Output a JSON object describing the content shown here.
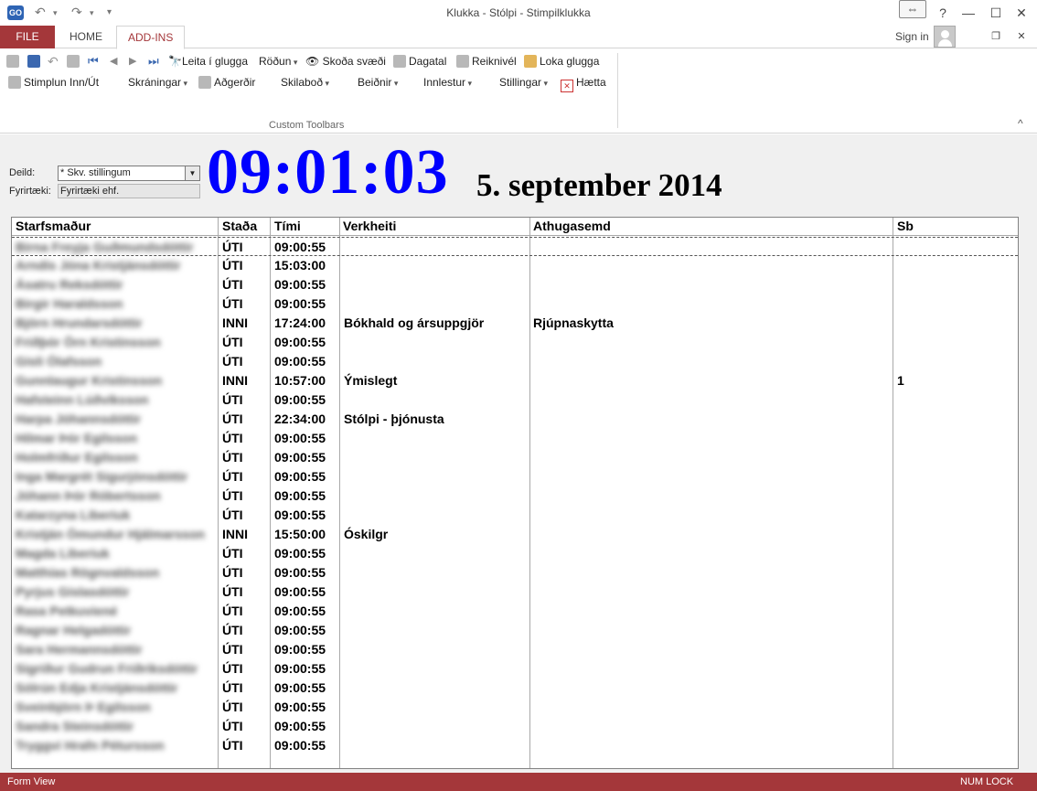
{
  "window": {
    "title": "Klukka - Stólpi - Stimpilklukka",
    "help": "?",
    "minimize": "—",
    "maximize": "☐",
    "close": "✕",
    "restore_ribbon": "⇔",
    "app_icon_text": "GO"
  },
  "tabs": {
    "file": "FILE",
    "home": "HOME",
    "addins": "ADD-INS"
  },
  "account": {
    "signin": "Sign in"
  },
  "ribbon": {
    "row1": {
      "leita": "Leita í glugga",
      "rodun": "Röðun",
      "skoda": "Skoða svæði",
      "dagatal": "Dagatal",
      "reiknivel": "Reiknivél",
      "loka": "Loka glugga"
    },
    "row2": {
      "stimplun": "Stimplun Inn/Út",
      "skraningar": "Skráningar",
      "adgerdir": "Aðgerðir",
      "skilabod": "Skilaboð",
      "beidnir": "Beiðnir",
      "innlestur": "Innlestur",
      "stillingar": "Stillingar",
      "haetta": "Hætta"
    },
    "group_label": "Custom Toolbars"
  },
  "form": {
    "deild_label": "Deild:",
    "deild_value": "* Skv. stillingum",
    "fyrirtaeki_label": "Fyrirtæki:",
    "fyrirtaeki_value": "Fyrirtæki ehf.",
    "clock": "09:01:03",
    "date": "5. september 2014"
  },
  "grid": {
    "columns": [
      "Starfsmaður",
      "Staða",
      "Tími",
      "Verkheiti",
      "Athugasemd",
      "Sb"
    ],
    "rows": [
      {
        "name": "Birna Freyja Guðmundsdóttir",
        "stada": "ÚTI",
        "timi": "09:00:55",
        "verk": "",
        "aths": "",
        "sb": ""
      },
      {
        "name": "Arndís Jóna Kristjánsdóttir",
        "stada": "ÚTI",
        "timi": "15:03:00",
        "verk": "",
        "aths": "",
        "sb": ""
      },
      {
        "name": "Ásatru Reksdóttir",
        "stada": "ÚTI",
        "timi": "09:00:55",
        "verk": "",
        "aths": "",
        "sb": ""
      },
      {
        "name": "Birgir Haraldsson",
        "stada": "ÚTI",
        "timi": "09:00:55",
        "verk": "",
        "aths": "",
        "sb": ""
      },
      {
        "name": "Björn Hrundarsdóttir",
        "stada": "INNI",
        "timi": "17:24:00",
        "verk": "Bókhald og ársuppgjör",
        "aths": "Rjúpnaskytta",
        "sb": ""
      },
      {
        "name": "Friðþór Örn Kristinsson",
        "stada": "ÚTI",
        "timi": "09:00:55",
        "verk": "",
        "aths": "",
        "sb": ""
      },
      {
        "name": "Gísli Ólafsson",
        "stada": "ÚTI",
        "timi": "09:00:55",
        "verk": "",
        "aths": "",
        "sb": ""
      },
      {
        "name": "Gunnlaugur Kristinsson",
        "stada": "INNI",
        "timi": "10:57:00",
        "verk": "Ýmislegt",
        "aths": "",
        "sb": "1"
      },
      {
        "name": "Hafsteinn Lúðvíksson",
        "stada": "ÚTI",
        "timi": "09:00:55",
        "verk": "",
        "aths": "",
        "sb": ""
      },
      {
        "name": "Harpa Jóhannsdóttir",
        "stada": "ÚTI",
        "timi": "22:34:00",
        "verk": "Stólpi - þjónusta",
        "aths": "",
        "sb": ""
      },
      {
        "name": "Hilmar Þór Egilsson",
        "stada": "ÚTI",
        "timi": "09:00:55",
        "verk": "",
        "aths": "",
        "sb": ""
      },
      {
        "name": "Holmfríður Egilsson",
        "stada": "ÚTI",
        "timi": "09:00:55",
        "verk": "",
        "aths": "",
        "sb": ""
      },
      {
        "name": "Inga Margrét Sigurjónsdóttir",
        "stada": "ÚTI",
        "timi": "09:00:55",
        "verk": "",
        "aths": "",
        "sb": ""
      },
      {
        "name": "Jóhann Þór Róbertsson",
        "stada": "ÚTI",
        "timi": "09:00:55",
        "verk": "",
        "aths": "",
        "sb": ""
      },
      {
        "name": "Katarzyna Liberiuk",
        "stada": "ÚTI",
        "timi": "09:00:55",
        "verk": "",
        "aths": "",
        "sb": ""
      },
      {
        "name": "Kristján Ómundur Hjálmarsson",
        "stada": "INNI",
        "timi": "15:50:00",
        "verk": "Óskilgr",
        "aths": "",
        "sb": ""
      },
      {
        "name": "Magda Liberiuk",
        "stada": "ÚTI",
        "timi": "09:00:55",
        "verk": "",
        "aths": "",
        "sb": ""
      },
      {
        "name": "Matthías Rögnvaldsson",
        "stada": "ÚTI",
        "timi": "09:00:55",
        "verk": "",
        "aths": "",
        "sb": ""
      },
      {
        "name": "Pyrjus Gíslasdóttir",
        "stada": "ÚTI",
        "timi": "09:00:55",
        "verk": "",
        "aths": "",
        "sb": ""
      },
      {
        "name": "Rasa Petkuviené",
        "stada": "ÚTI",
        "timi": "09:00:55",
        "verk": "",
        "aths": "",
        "sb": ""
      },
      {
        "name": "Ragnar Helgadóttir",
        "stada": "ÚTI",
        "timi": "09:00:55",
        "verk": "",
        "aths": "",
        "sb": ""
      },
      {
        "name": "Sara Hermannsdóttir",
        "stada": "ÚTI",
        "timi": "09:00:55",
        "verk": "",
        "aths": "",
        "sb": ""
      },
      {
        "name": "Sigríður Gudrun Friðriksdóttir",
        "stada": "ÚTI",
        "timi": "09:00:55",
        "verk": "",
        "aths": "",
        "sb": ""
      },
      {
        "name": "Sólrún Edja Kristjánsdóttir",
        "stada": "ÚTI",
        "timi": "09:00:55",
        "verk": "",
        "aths": "",
        "sb": ""
      },
      {
        "name": "Sveinbjörn Þ Egilsson",
        "stada": "ÚTI",
        "timi": "09:00:55",
        "verk": "",
        "aths": "",
        "sb": ""
      },
      {
        "name": "Sandra Steinsdóttir",
        "stada": "ÚTI",
        "timi": "09:00:55",
        "verk": "",
        "aths": "",
        "sb": ""
      },
      {
        "name": "Tryggvi Hrafn Pétursson",
        "stada": "ÚTI",
        "timi": "09:00:55",
        "verk": "",
        "aths": "",
        "sb": ""
      }
    ]
  },
  "status": {
    "left": "Form View",
    "right": "NUM LOCK"
  }
}
